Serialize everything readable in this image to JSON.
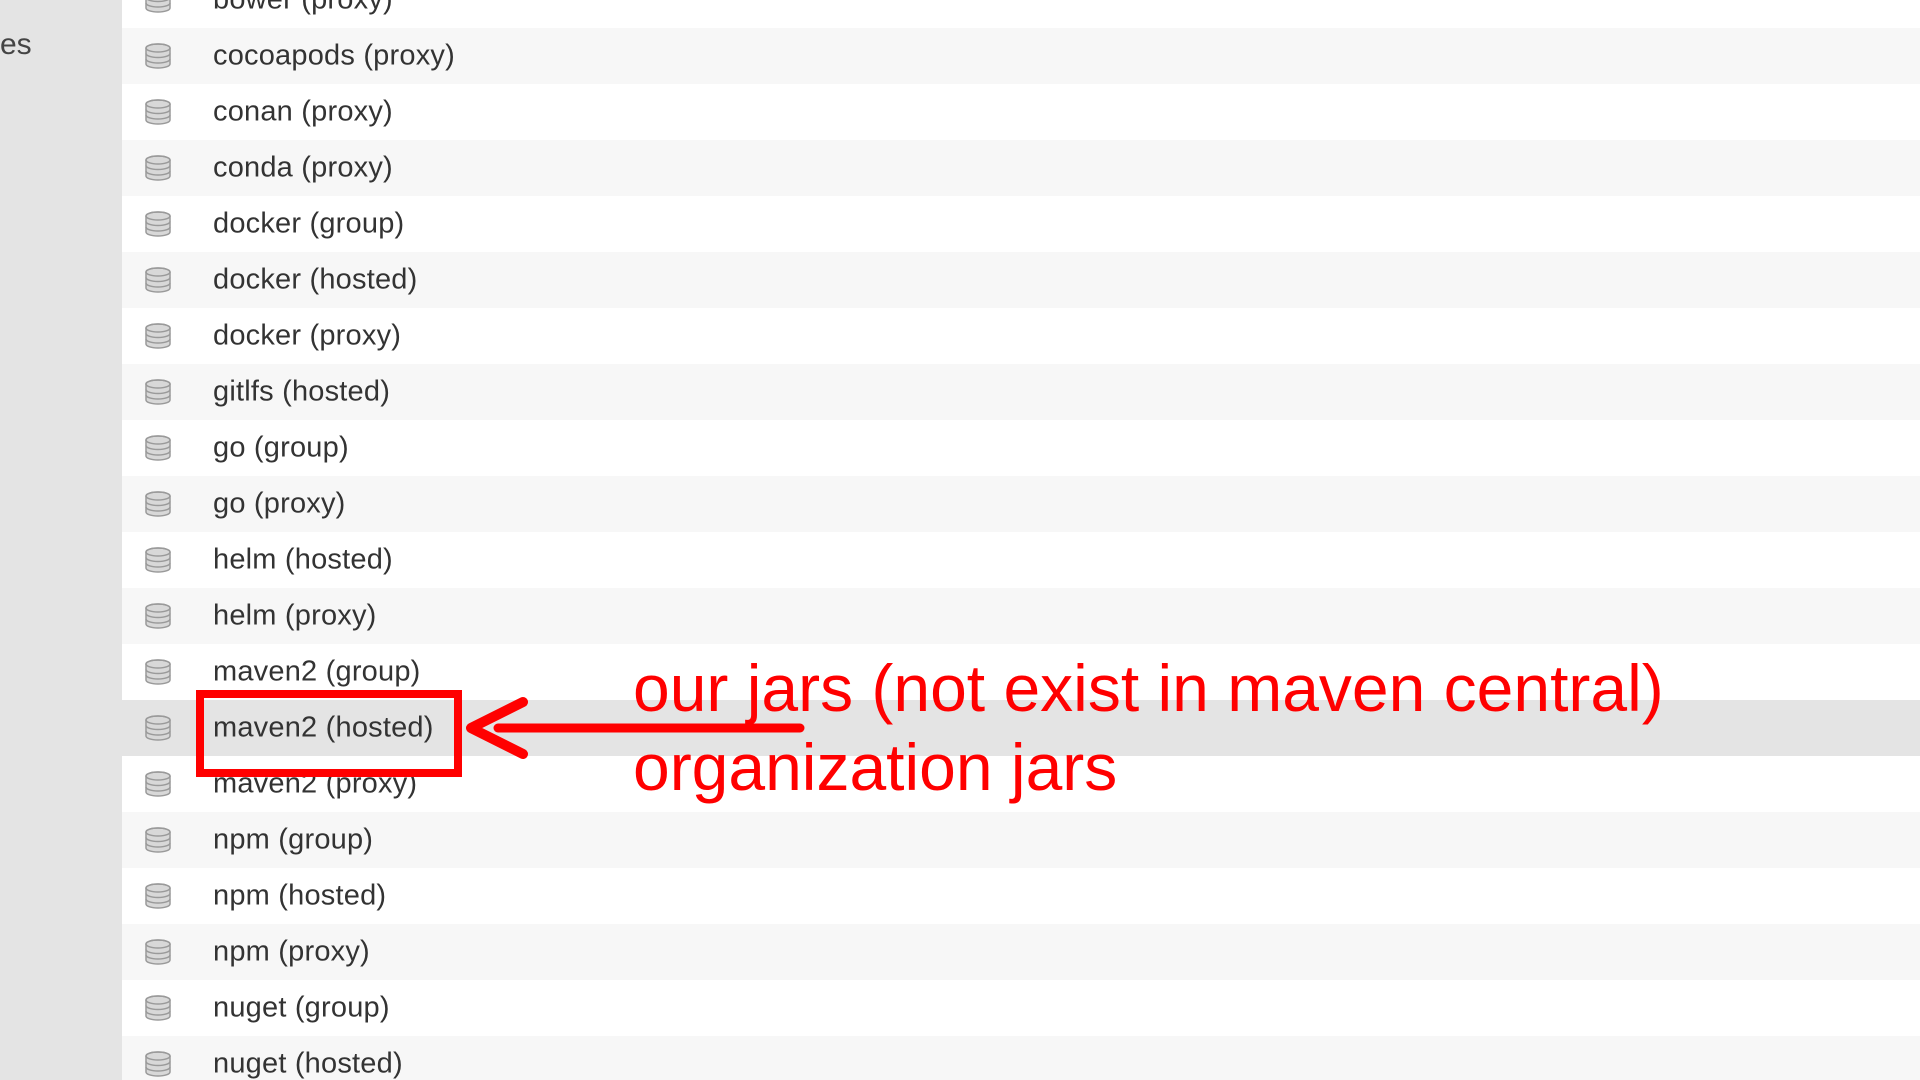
{
  "sidebar": {
    "partial_label": "es"
  },
  "repositories": [
    {
      "name": "bower (proxy)",
      "icon": "database-icon"
    },
    {
      "name": "cocoapods (proxy)",
      "icon": "database-icon"
    },
    {
      "name": "conan (proxy)",
      "icon": "database-icon"
    },
    {
      "name": "conda (proxy)",
      "icon": "database-icon"
    },
    {
      "name": "docker (group)",
      "icon": "database-icon"
    },
    {
      "name": "docker (hosted)",
      "icon": "database-icon"
    },
    {
      "name": "docker (proxy)",
      "icon": "database-icon"
    },
    {
      "name": "gitlfs (hosted)",
      "icon": "database-icon"
    },
    {
      "name": "go (group)",
      "icon": "database-icon"
    },
    {
      "name": "go (proxy)",
      "icon": "database-icon"
    },
    {
      "name": "helm (hosted)",
      "icon": "database-icon"
    },
    {
      "name": "helm (proxy)",
      "icon": "database-icon"
    },
    {
      "name": "maven2 (group)",
      "icon": "database-icon"
    },
    {
      "name": "maven2 (hosted)",
      "icon": "database-icon",
      "selected": true
    },
    {
      "name": "maven2 (proxy)",
      "icon": "database-icon"
    },
    {
      "name": "npm (group)",
      "icon": "database-icon"
    },
    {
      "name": "npm (hosted)",
      "icon": "database-icon"
    },
    {
      "name": "npm (proxy)",
      "icon": "database-icon"
    },
    {
      "name": "nuget (group)",
      "icon": "database-icon"
    },
    {
      "name": "nuget (hosted)",
      "icon": "database-icon"
    }
  ],
  "annotation": {
    "line1": "our jars (not exist in maven central)",
    "line2": "organization jars",
    "color": "#ff0000"
  },
  "colors": {
    "sidebar_bg": "#e4e4e4",
    "row_alt_bg": "#f7f7f7",
    "selected_row_bg": "#e4e4e4",
    "text": "#333333"
  }
}
